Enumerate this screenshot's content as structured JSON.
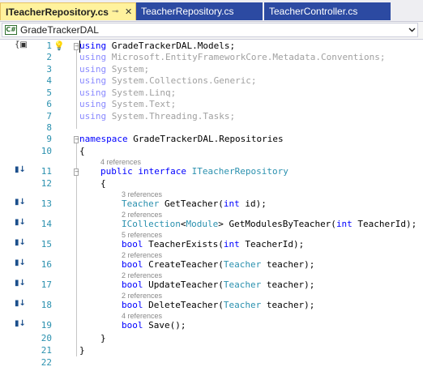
{
  "tabs": [
    {
      "label": "ITeacherRepository.cs",
      "active": true
    },
    {
      "label": "TeacherRepository.cs",
      "active": false
    },
    {
      "label": "TeacherController.cs",
      "active": false
    }
  ],
  "tab_pin_glyph": "⊸",
  "tab_close_glyph": "✕",
  "nav": {
    "project_icon_text": "C#",
    "project": "GradeTrackerDAL"
  },
  "editor": {
    "lines": {
      "1": {
        "n": "1",
        "kw": "using",
        "rest": " GradeTrackerDAL.Models;"
      },
      "2": {
        "n": "2",
        "kw": "using",
        "rest": " Microsoft.EntityFrameworkCore.Metadata.Conventions;"
      },
      "3": {
        "n": "3",
        "kw": "using",
        "rest": " System;"
      },
      "4": {
        "n": "4",
        "kw": "using",
        "rest": " System.Collections.Generic;"
      },
      "5": {
        "n": "5",
        "kw": "using",
        "rest": " System.Linq;"
      },
      "6": {
        "n": "6",
        "kw": "using",
        "rest": " System.Text;"
      },
      "7": {
        "n": "7",
        "kw": "using",
        "rest": " System.Threading.Tasks;"
      },
      "8": {
        "n": "8"
      },
      "9": {
        "n": "9",
        "kw": "namespace",
        "rest": " GradeTrackerDAL.Repositories"
      },
      "10": {
        "n": "10",
        "text": "{"
      },
      "11": {
        "n": "11",
        "refs": "4 references",
        "kw1": "public",
        "kw2": "interface",
        "type": "ITeacherRepository"
      },
      "12": {
        "n": "12",
        "text": "{"
      },
      "13": {
        "n": "13",
        "refs": "3 references",
        "type": "Teacher",
        "mid": " GetTeacher(",
        "kw": "int",
        "end": " id);"
      },
      "14": {
        "n": "14",
        "refs": "2 references",
        "type1": "ICollection",
        "lt": "<",
        "type2": "Module",
        "mid": "> GetModulesByTeacher(",
        "kw": "int",
        "end": " TeacherId);"
      },
      "15": {
        "n": "15",
        "refs": "5 references",
        "kw1": "bool",
        "mid": " TeacherExists(",
        "kw2": "int",
        "end": " TeacherId);"
      },
      "16": {
        "n": "16",
        "refs": "2 references",
        "kw": "bool",
        "mid": " CreateTeacher(",
        "type": "Teacher",
        "end": " teacher);"
      },
      "17": {
        "n": "17",
        "refs": "2 references",
        "kw": "bool",
        "mid": " UpdateTeacher(",
        "type": "Teacher",
        "end": " teacher);"
      },
      "18": {
        "n": "18",
        "refs": "2 references",
        "kw": "bool",
        "mid": " DeleteTeacher(",
        "type": "Teacher",
        "end": " teacher);"
      },
      "19": {
        "n": "19",
        "refs": "4 references",
        "kw": "bool",
        "mid": " Save();"
      },
      "20": {
        "n": "20",
        "text": "}"
      },
      "21": {
        "n": "21",
        "text": "}"
      },
      "22": {
        "n": "22"
      }
    },
    "margin_glyph": "▮↓",
    "colors": {
      "keyword": "#0000ff",
      "type": "#2b91af",
      "line_number": "#2b91af",
      "unused_using": "#a0a0a0",
      "reference_hint": "#888888",
      "active_tab": "#fff29d",
      "inactive_tab": "#2c4aa2"
    }
  }
}
